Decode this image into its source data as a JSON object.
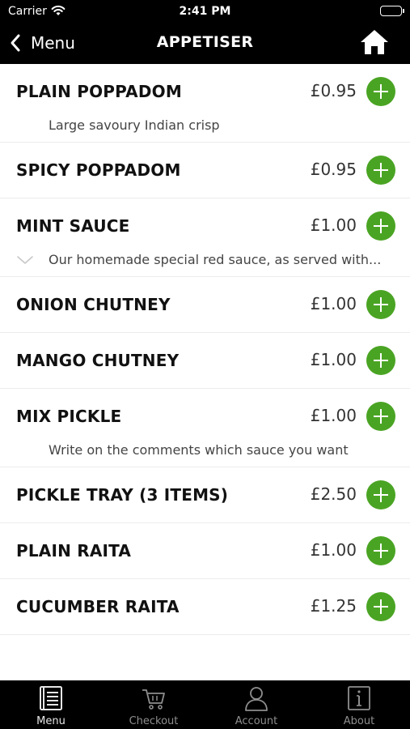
{
  "status_bar": {
    "carrier": "Carrier",
    "time": "2:41 PM"
  },
  "nav": {
    "back_label": "Menu",
    "title": "APPETISER"
  },
  "items": [
    {
      "name": "PLAIN POPPADOM",
      "price": "£0.95",
      "description": "Large savoury Indian crisp"
    },
    {
      "name": "SPICY POPPADOM",
      "price": "£0.95"
    },
    {
      "name": "MINT SAUCE",
      "price": "£1.00",
      "description": "Our homemade special red sauce, as served with...",
      "expandable": true
    },
    {
      "name": "ONION CHUTNEY",
      "price": "£1.00"
    },
    {
      "name": "MANGO CHUTNEY",
      "price": "£1.00"
    },
    {
      "name": "MIX PICKLE",
      "price": "£1.00",
      "description": "Write on the comments which sauce you want"
    },
    {
      "name": "PICKLE TRAY (3 ITEMS)",
      "price": "£2.50"
    },
    {
      "name": "PLAIN RAITA",
      "price": "£1.00"
    },
    {
      "name": "CUCUMBER RAITA",
      "price": "£1.25"
    }
  ],
  "tabs": [
    {
      "label": "Menu",
      "icon": "menu-book-icon",
      "active": true
    },
    {
      "label": "Checkout",
      "icon": "cart-icon",
      "active": false
    },
    {
      "label": "Account",
      "icon": "person-icon",
      "active": false
    },
    {
      "label": "About",
      "icon": "info-icon",
      "active": false
    }
  ],
  "colors": {
    "add_button": "#4aa423",
    "bars": "#000000",
    "tab_active": "#e6e6e6",
    "tab_inactive": "#8e8e8e"
  }
}
